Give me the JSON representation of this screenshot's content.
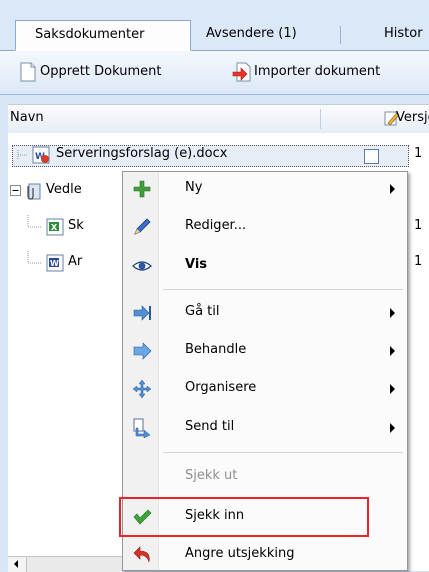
{
  "tabs": [
    {
      "label": "Saksdokumenter",
      "active": true
    },
    {
      "label": "Avsendere (1)",
      "active": false
    },
    {
      "label": "Histor",
      "active": false
    }
  ],
  "toolbar": {
    "create_label": "Opprett Dokument",
    "import_label": "Importer dokument"
  },
  "columns": {
    "name": "Navn",
    "version": "Versjo"
  },
  "rows": [
    {
      "name": "Serveringsforslag (e).docx",
      "version": "1"
    },
    {
      "name": "Vedle",
      "version": ""
    },
    {
      "name": "Sk",
      "version": "1"
    },
    {
      "name": "Ar",
      "version": "1"
    }
  ],
  "menu": {
    "items": [
      {
        "label": "Ny",
        "icon": "plus-icon"
      },
      {
        "label": "Rediger...",
        "icon": "pencil-icon"
      },
      {
        "label": "Vis",
        "icon": "eye-icon"
      },
      {
        "label": "Gå til",
        "icon": "goto-arrow-icon"
      },
      {
        "label": "Behandle",
        "icon": "process-arrow-icon"
      },
      {
        "label": "Organisere",
        "icon": "move-icon"
      },
      {
        "label": "Send til",
        "icon": "send-icon"
      },
      {
        "label": "Sjekk ut",
        "icon": ""
      },
      {
        "label": "Sjekk inn",
        "icon": "checkmark-icon"
      },
      {
        "label": "Angre utsjekking",
        "icon": "undo-icon"
      }
    ]
  },
  "colors": {
    "highlight_box": "#e8232a",
    "tab_border": "#8ea8cc",
    "selection": "#316ac5"
  }
}
